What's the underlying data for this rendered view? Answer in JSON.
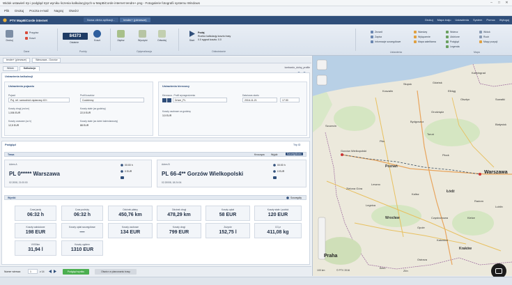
{
  "window": {
    "title": "Widok ustawień Irp i podgląd Irp2 wyniku liczenia kalkulacyjnych w MapBiCorde internet tendre+.png - Fotogalerie fotografii systemu Windows"
  },
  "explorer_menu": [
    "Plik",
    "Drukuj",
    "Poczta e-mail",
    "Nagraj",
    "Otwórz"
  ],
  "app": {
    "brand": "PTV MapBiCorde internet",
    "tabs": [
      "Nowa oferta aplikacji...",
      "tender+ (pierwsze)"
    ],
    "menu": [
      "Drukuj",
      "Mapa kraju",
      "Ustawienia",
      "System",
      "Pomoc",
      "Wyloguj"
    ]
  },
  "ribbon": {
    "counter_value": "84373",
    "counter_label": "Ostatnie",
    "buttons": [
      "Drukuj",
      "Przypisz",
      "Koszt",
      "Zapisz",
      "Wyczyść",
      "Odwołaj",
      "Start"
    ],
    "groups": [
      "Dane",
      "Punkty",
      "Optymalizacja",
      "Ustawienia",
      "Odświeżanie",
      "Mapa"
    ],
    "start_info": [
      "Podaj",
      "Rozlicz kalkulację kosztu trasy",
      "0.0 sygnał kosztu: 0.0"
    ],
    "right_items": [
      "Zezwól",
      "Zapisz",
      "Informacje szczegółowe",
      "Warstwy",
      "Wyłączenie",
      "Mapa satelitarna",
      "Wstecz",
      "Ulubione",
      "Podgląd",
      "Legenda",
      "Widok",
      "Ruch",
      "Mapy pozycji"
    ]
  },
  "doc_tabs": [
    "tender+ (pierwsze)",
    "Warszawa - Gorzów"
  ],
  "sub_tabs": [
    "Widok",
    "Kalkulacja"
  ],
  "path_label": "lombardo_dolny_profile",
  "calc": {
    "title": "Ustawienia kalkulacji",
    "vehicle": {
      "title": "Ustawienia pojazdu",
      "vehicle_label": "Pojazd",
      "vehicle_value": "Poj. ref. samochód ciężarowy 40 t",
      "cost_profile_label": "Profil kosztów",
      "cost_profile_value": "Codzienny",
      "cost_km_label": "Koszty drogi (za km)",
      "cost_km_value": "1,006 EUR",
      "fixed_cost_label": "Koszty stałe (za godzinę)",
      "fixed_cost_value": "22,5 EUR",
      "time_cost_label": "Koszty czasowe (za h)",
      "time_cost_value": "12,5 EUR",
      "fixed_daily_label": "Koszty stałe (za dzień kalendarzowy)",
      "fixed_daily_value": "88 EUR"
    },
    "driver": {
      "title": "Ustawienia kierowcy",
      "driver_label": "Kierowca - Profil wynagrodzenia",
      "driver_value": "Driver_PL",
      "date_label": "Data/czas startu",
      "date_value": "2016-11-21",
      "time_value": "17:30",
      "hours_label": "Koszty osobowe za godzinę",
      "hours_value": "3,5 EUR"
    }
  },
  "results": {
    "title": "Podgląd",
    "top_link": "Trip ID",
    "route_section": "Trasa",
    "route_toggles": [
      "Krocząca",
      "Wyjdź",
      "Szczegółowo"
    ],
    "stop_a": {
      "label": "Adres A",
      "name": "PL 0***** Warszawa",
      "date": "02.2008, 21:00:00",
      "duration": "00:00 h",
      "cost": "0 EUR"
    },
    "stop_b": {
      "label": "Adres B",
      "name": "PL 66-4** Gorzów Wielkopolski",
      "date": "02.20008, 18:24:04",
      "duration": "00:00 h",
      "cost": "0 EUR"
    },
    "summary_title": "Wyniki",
    "summary_link": "Szczegóły",
    "stats_row1": [
      {
        "label": "Czas jazdy",
        "value": "06:32 h"
      },
      {
        "label": "Czas podróży",
        "value": "06:32 h"
      },
      {
        "label": "Odcinek płatny",
        "value": "450,76 km"
      },
      {
        "label": "Odcinek drogi",
        "value": "478,29 km"
      },
      {
        "label": "Koszty opłat",
        "value": "58 EUR"
      },
      {
        "label": "Koszty stałe / podróż",
        "value": "120 EUR"
      }
    ],
    "stats_row2": [
      {
        "label": "Koszty całościowe",
        "value": "198 EUR"
      },
      {
        "label": "Koszty opłat szczegółowe",
        "value": "—"
      },
      {
        "label": "Koszty osobowe",
        "value": "134 EUR"
      },
      {
        "label": "Koszty drogi",
        "value": "799 EUR"
      },
      {
        "label": "Zużycie",
        "value": "152,75 l"
      },
      {
        "label": "CO₂e",
        "value": "411,08 kg"
      }
    ],
    "stats_row3": [
      {
        "label": "VV00km",
        "value": "31,94 l"
      },
      {
        "label": "Koszty ogółem",
        "value": "1310 EUR"
      }
    ]
  },
  "bottom": {
    "nav_label": "Numer wiersza",
    "page_value": "1",
    "page_total": "z 14",
    "primary_button": "Podgląd wyniku",
    "secondary_button": "Otwórz w planowaniu trasy"
  },
  "map": {
    "cities_big": [
      "Warszawa",
      "Praha"
    ],
    "cities_med": [
      "Poznań",
      "Łódź",
      "Wrocław",
      "Kraków"
    ],
    "cities_small": [
      "Kaliningrad",
      "Gdańsk",
      "Olsztyn",
      "Bydgoszcz",
      "Toruń",
      "Szczecin",
      "Gorzów Wielkopolski",
      "Zielona Góra",
      "Legnica",
      "Opole",
      "Katowice",
      "Częstochowa",
      "Kielce",
      "Radom",
      "Lublin",
      "Białystok",
      "Płock",
      "Kalisz",
      "Ostrava",
      "Brno",
      "Zlín",
      "Koszalin",
      "Słupsk",
      "Elbląg",
      "Grudziądz",
      "Suwałki",
      "Leszno",
      "Piła"
    ],
    "scale": "100 km",
    "copyright": "© PTV 2016"
  },
  "colors": {
    "brand": "#2f4e7a",
    "primary_button": "#4caf50",
    "route_line": "#4a5a6a"
  }
}
